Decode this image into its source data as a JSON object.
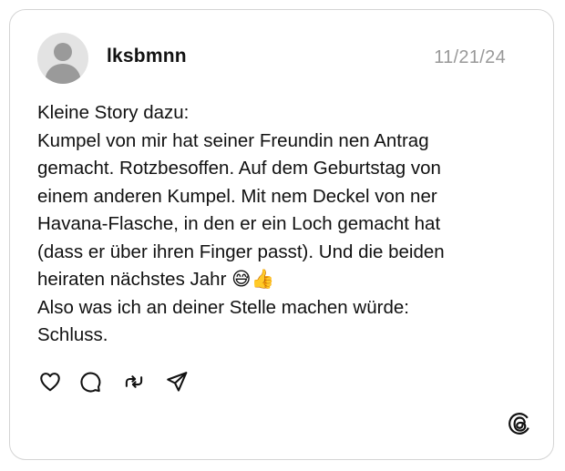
{
  "post": {
    "username": "lksbmnn",
    "date": "11/21/24",
    "lines": [
      "Kleine Story dazu:",
      "Kumpel von mir hat seiner Freundin nen Antrag",
      "gemacht. Rotzbesoffen. Auf dem Geburtstag von",
      "einem anderen Kumpel. Mit nem Deckel von ner",
      "Havana-Flasche, in den er ein Loch gemacht hat",
      "(dass er über ihren Finger passt). Und die beiden",
      "heiraten nächstes Jahr 😅👍",
      "Also was ich an deiner Stelle machen würde:",
      "Schluss."
    ]
  },
  "actions": {
    "icons": [
      "heart-icon",
      "comment-icon",
      "repost-icon",
      "share-icon"
    ]
  },
  "brand": {
    "logo": "threads-logo"
  },
  "colors": {
    "text": "#111111",
    "muted": "#999999",
    "border": "#d4d4d4",
    "avatar_bg": "#e3e3e3",
    "avatar_fg": "#9a9a9a"
  }
}
